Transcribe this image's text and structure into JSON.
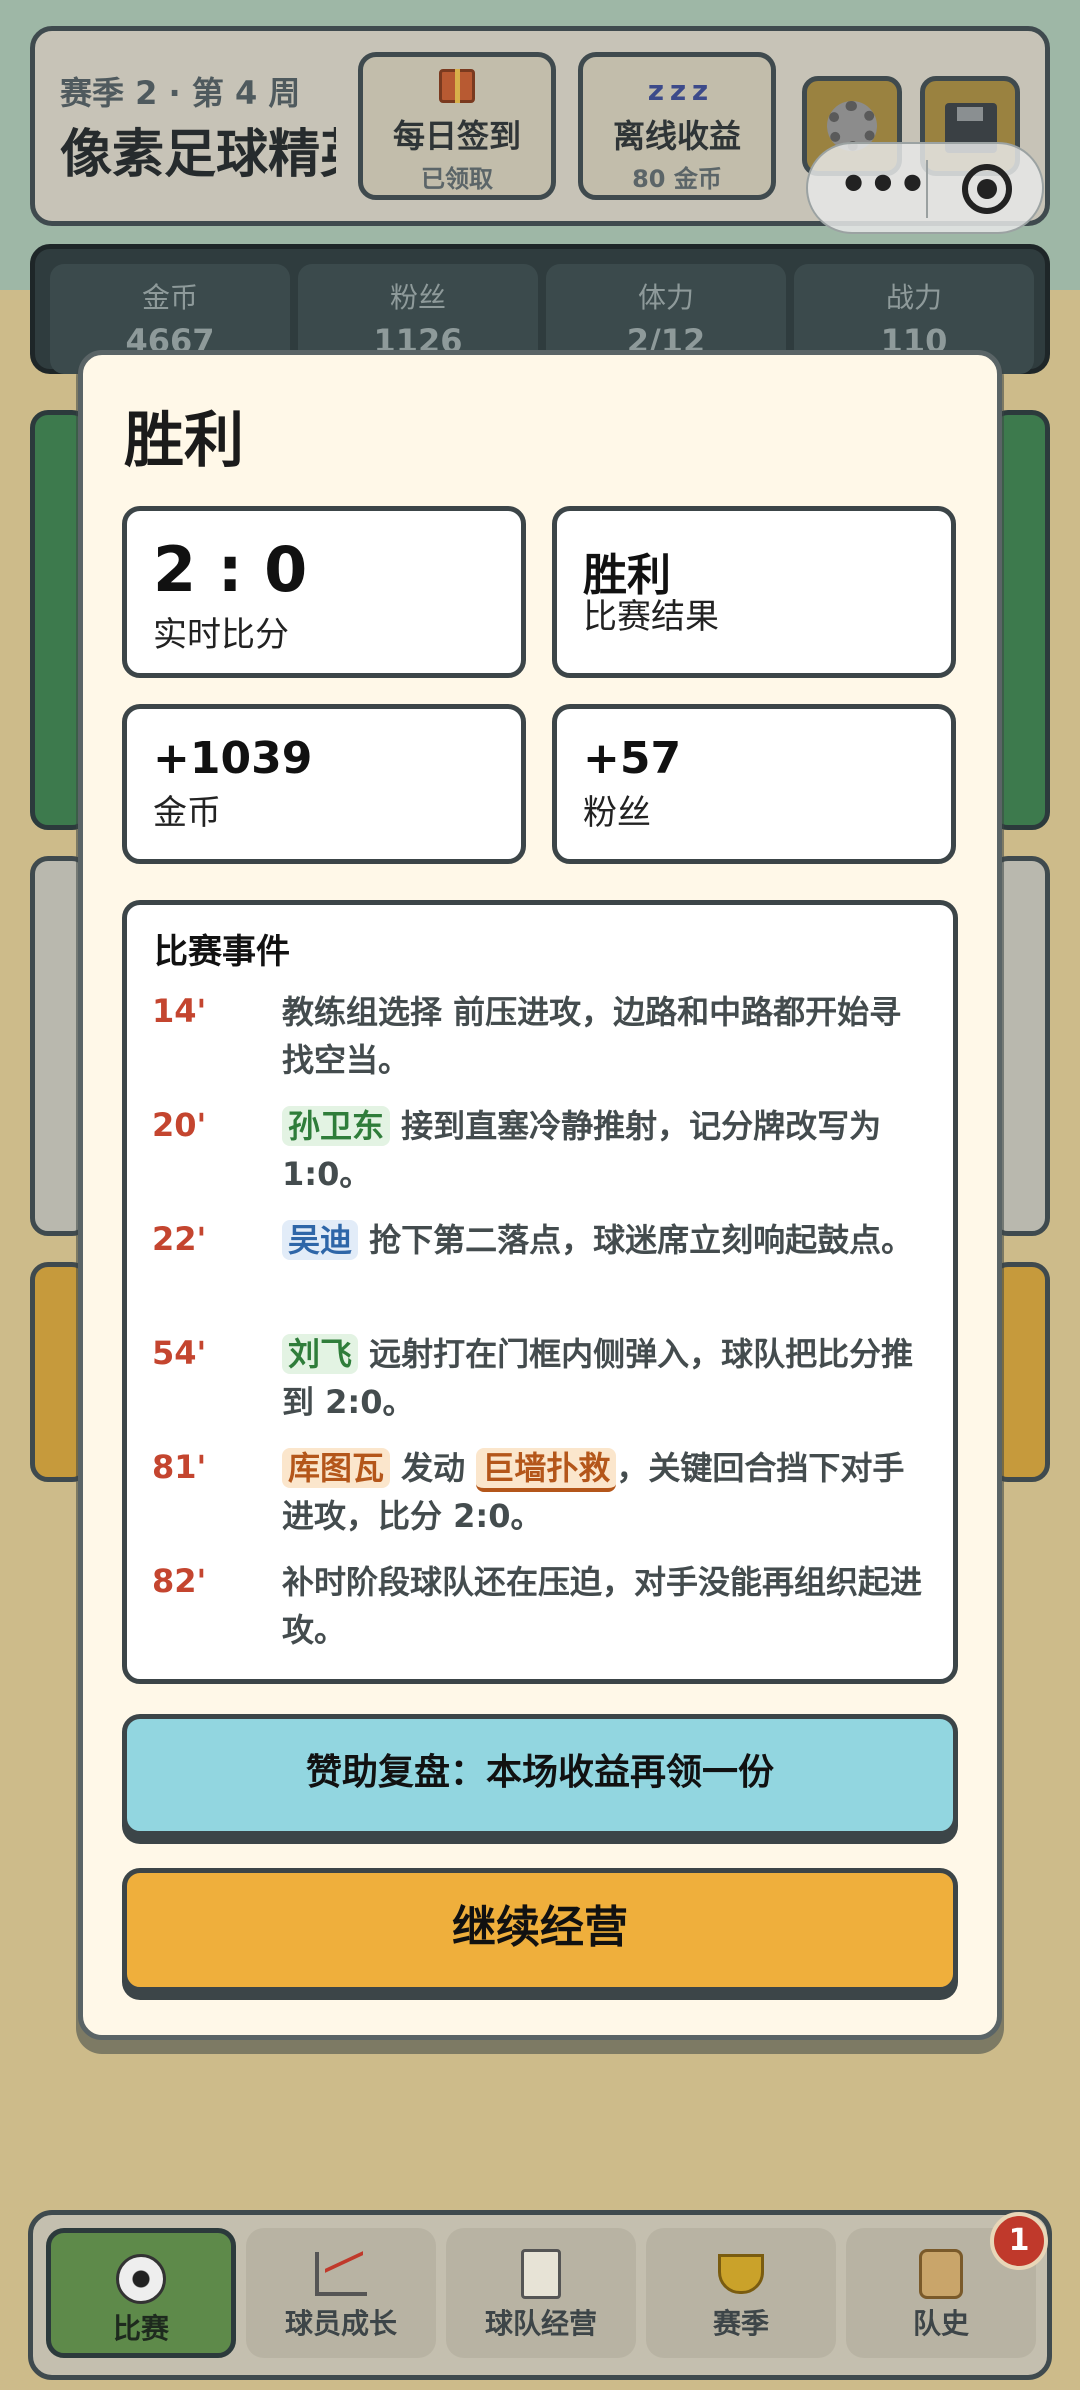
{
  "header": {
    "season_week": "赛季 2 · 第 4 周",
    "game_title": "像素足球精英",
    "daily_checkin": {
      "label": "每日签到",
      "status": "已领取"
    },
    "offline_income": {
      "label": "离线收益",
      "amount": "80 金币"
    }
  },
  "capsule": {
    "more_icon": "•••"
  },
  "stats": [
    {
      "label": "金币",
      "value": "4667"
    },
    {
      "label": "粉丝",
      "value": "1126"
    },
    {
      "label": "体力",
      "value": "2/12"
    },
    {
      "label": "战力",
      "value": "110"
    }
  ],
  "modal": {
    "title": "胜利",
    "score": {
      "value": "2 : 0",
      "label": "实时比分"
    },
    "result": {
      "value": "胜利",
      "label": "比赛结果"
    },
    "coins": {
      "value": "+1039",
      "label": "金币"
    },
    "fans": {
      "value": "+57",
      "label": "粉丝"
    },
    "events_title": "比赛事件",
    "events": [
      {
        "minute": "14'",
        "text": "教练组选择 前压进攻，边路和中路都开始寻找空当。"
      },
      {
        "minute": "20'",
        "player": "孙卫东",
        "text": " 接到直塞冷静推射，记分牌改写为 1:0。"
      },
      {
        "minute": "22'",
        "player": "吴迪",
        "text": " 抢下第二落点，球迷席立刻响起鼓点。"
      },
      {
        "minute": "54'",
        "player": "刘飞",
        "text": " 远射打在门框内侧弹入，球队把比分推到 2:0。"
      },
      {
        "minute": "81'",
        "player": "库图瓦",
        "mid": " 发动 ",
        "skill": "巨墙扑救",
        "text": "，关键回合挡下对手进攻，比分 2:0。"
      },
      {
        "minute": "82'",
        "text": "补时阶段球队还在压迫，对手没能再组织起进攻。"
      }
    ],
    "sponsor_button": "赞助复盘：本场收益再领一份",
    "continue_button": "继续经营"
  },
  "bottom_nav": [
    {
      "label": "比赛",
      "icon": "soccer-ball-icon",
      "active": true
    },
    {
      "label": "球员成长",
      "icon": "chart-icon"
    },
    {
      "label": "球队经营",
      "icon": "clipboard-icon"
    },
    {
      "label": "赛季",
      "icon": "trophy-icon"
    },
    {
      "label": "队史",
      "icon": "scroll-icon"
    }
  ],
  "notification_badge": "1",
  "colors": {
    "modal_bg": "#fff8e8",
    "minute": "#c4452f",
    "sponsor": "#92d6e0",
    "continue": "#efaf3c",
    "nav_active": "#5e8a4a"
  }
}
